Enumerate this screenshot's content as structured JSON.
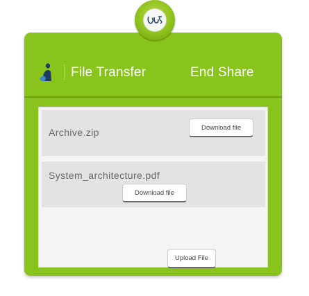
{
  "emblem": {
    "text": "ഗ്ദ"
  },
  "header": {
    "icon": "person-icon",
    "title": "File Transfer",
    "end_share_label": "End Share"
  },
  "files": [
    {
      "name": "Archive.zip",
      "download_label": "Download file"
    },
    {
      "name": "System_architecture.pdf",
      "download_label": "Download file"
    }
  ],
  "upload_label": "Upload File",
  "colors": {
    "accent": "#88c41c",
    "panel_dark": "#6d9e10",
    "content_bg": "#f4f4f4",
    "row_bg": "#e3e3e3"
  }
}
